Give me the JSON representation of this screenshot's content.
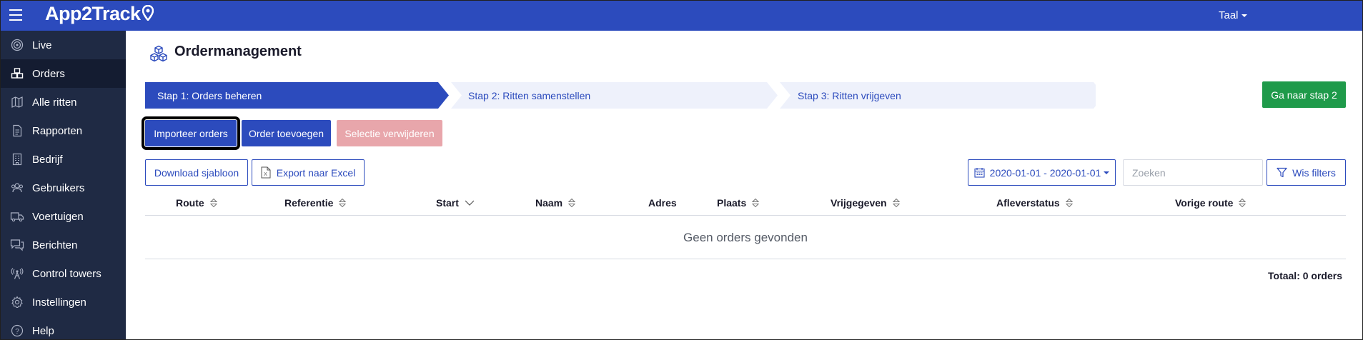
{
  "app": {
    "logo_text": "App2Track",
    "language_label": "Taal"
  },
  "sidebar": {
    "items": [
      {
        "label": "Live",
        "icon": "live-icon"
      },
      {
        "label": "Orders",
        "icon": "orders-icon",
        "active": true
      },
      {
        "label": "Alle ritten",
        "icon": "map-icon"
      },
      {
        "label": "Rapporten",
        "icon": "report-icon"
      },
      {
        "label": "Bedrijf",
        "icon": "building-icon"
      },
      {
        "label": "Gebruikers",
        "icon": "users-icon"
      },
      {
        "label": "Voertuigen",
        "icon": "truck-icon"
      },
      {
        "label": "Berichten",
        "icon": "messages-icon"
      },
      {
        "label": "Control towers",
        "icon": "tower-icon"
      },
      {
        "label": "Instellingen",
        "icon": "gear-icon"
      },
      {
        "label": "Help",
        "icon": "help-icon"
      }
    ]
  },
  "page": {
    "title": "Ordermanagement"
  },
  "steps": {
    "step1": "Stap 1: Orders beheren",
    "step2": "Stap 2: Ritten samenstellen",
    "step3": "Stap 3: Ritten vrijgeven",
    "next_button": "Ga naar stap 2"
  },
  "actions": {
    "import": "Importeer orders",
    "add": "Order toevoegen",
    "delete": "Selectie verwijderen",
    "download_template": "Download sjabloon",
    "export_excel": "Export naar Excel",
    "date_range": "2020-01-01 - 2020-01-01",
    "search_placeholder": "Zoeken",
    "clear_filters": "Wis filters"
  },
  "table": {
    "columns": [
      "Route",
      "Referentie",
      "Start",
      "Naam",
      "Adres",
      "Plaats",
      "Vrijgegeven",
      "Afleverstatus",
      "Vorige route"
    ],
    "empty_message": "Geen orders gevonden",
    "total": "Totaal: 0 orders"
  },
  "colors": {
    "brand_blue": "#2c4bbd",
    "sidebar": "#1f2a44",
    "success": "#1f9a4a",
    "danger_disabled": "#e8a6ab"
  }
}
